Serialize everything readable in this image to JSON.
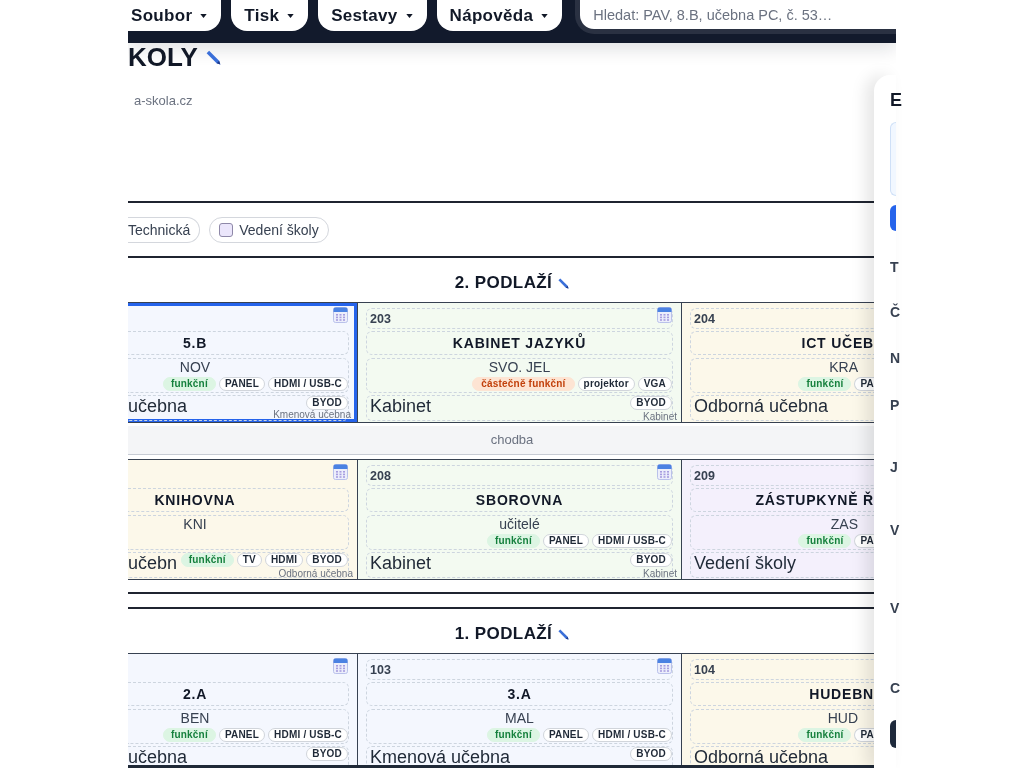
{
  "menu": [
    {
      "label": "Soubor"
    },
    {
      "label": "Tisk"
    },
    {
      "label": "Sestavy"
    },
    {
      "label": "Nápověda"
    }
  ],
  "search": {
    "placeholder": "Hledat: PAV, 8.B, učebna PC, č. 53…"
  },
  "page": {
    "title": "KOLY",
    "subtitle": "a-skola.cz"
  },
  "filters": [
    {
      "label": "Technická"
    },
    {
      "label": "Vedení školy",
      "checked": false,
      "color": "#ebe6fb"
    }
  ],
  "floors": [
    {
      "title": "2. PODLAŽÍ",
      "rows": [
        {
          "kind": "rooms",
          "rooms": [
            {
              "name": "5.B",
              "teacher": "NOV",
              "tags": [
                {
                  "label": "funkční",
                  "kind": "ok"
                },
                {
                  "label": "PANEL",
                  "kind": "feature"
                },
                {
                  "label": "HDMI / USB-C",
                  "kind": "feature"
                }
              ],
              "type": "učebna",
              "bottom_tags": [
                {
                  "label": "BYOD",
                  "kind": "feature"
                }
              ],
              "type_label": "Kmenová učebna",
              "color": "#f4f7fe",
              "selected": true
            },
            {
              "number": "203",
              "name": "KABINET JAZYKŮ",
              "teacher": "SVO. JEL",
              "tags": [
                {
                  "label": "částečně funkční",
                  "kind": "partial"
                },
                {
                  "label": "projektor",
                  "kind": "feature"
                },
                {
                  "label": "VGA",
                  "kind": "feature"
                }
              ],
              "type": "Kabinet",
              "bottom_tags": [
                {
                  "label": "BYOD",
                  "kind": "feature"
                }
              ],
              "type_label": "Kabinet",
              "color": "#f3faf1",
              "selected": false
            },
            {
              "number": "204",
              "name": "ICT UČEB",
              "teacher": "KRA",
              "tags": [
                {
                  "label": "funkční",
                  "kind": "ok"
                },
                {
                  "label": "PA",
                  "kind": "feature"
                }
              ],
              "type": "Odborná učebna",
              "color": "#fcf8ea",
              "selected": false
            }
          ]
        },
        {
          "kind": "corridor",
          "label": "chodba"
        },
        {
          "kind": "rooms",
          "rooms": [
            {
              "name": "KNIHOVNA",
              "teacher": "KNI",
              "type": "učebn",
              "bottom_tags": [
                {
                  "label": "funkční",
                  "kind": "ok"
                },
                {
                  "label": "TV",
                  "kind": "feature"
                },
                {
                  "label": "HDMI",
                  "kind": "feature"
                },
                {
                  "label": "BYOD",
                  "kind": "feature"
                }
              ],
              "type_label": "Odborná učebna",
              "color": "#fcf8ea",
              "selected": false
            },
            {
              "number": "208",
              "name": "SBOROVNA",
              "teacher": "učitelé",
              "tags": [
                {
                  "label": "funkční",
                  "kind": "ok"
                },
                {
                  "label": "PANEL",
                  "kind": "feature"
                },
                {
                  "label": "HDMI / USB-C",
                  "kind": "feature"
                }
              ],
              "type": "Kabinet",
              "bottom_tags": [
                {
                  "label": "BYOD",
                  "kind": "feature"
                }
              ],
              "type_label": "Kabinet",
              "color": "#f3faf1",
              "selected": false
            },
            {
              "number": "209",
              "name": "ZÁSTUPKYNĚ Ř",
              "teacher": "ZAS",
              "tags": [
                {
                  "label": "funkční",
                  "kind": "ok"
                },
                {
                  "label": "PA",
                  "kind": "feature"
                }
              ],
              "type": "Vedení školy",
              "color": "#f4f0fc",
              "selected": false
            }
          ]
        }
      ]
    },
    {
      "title": "1. PODLAŽÍ",
      "rows": [
        {
          "kind": "rooms",
          "rooms": [
            {
              "name": "2.A",
              "teacher": "BEN",
              "tags": [
                {
                  "label": "funkční",
                  "kind": "ok"
                },
                {
                  "label": "PANEL",
                  "kind": "feature"
                },
                {
                  "label": "HDMI / USB-C",
                  "kind": "feature"
                }
              ],
              "type": "učebna",
              "bottom_tags": [
                {
                  "label": "BYOD",
                  "kind": "feature"
                }
              ],
              "color": "#f4f7fe",
              "selected": false
            },
            {
              "number": "103",
              "name": "3.A",
              "teacher": "MAL",
              "tags": [
                {
                  "label": "funkční",
                  "kind": "ok"
                },
                {
                  "label": "PANEL",
                  "kind": "feature"
                },
                {
                  "label": "HDMI / USB-C",
                  "kind": "feature"
                }
              ],
              "type": "Kmenová učebna",
              "bottom_tags": [
                {
                  "label": "BYOD",
                  "kind": "feature"
                }
              ],
              "color": "#f4f7fe",
              "selected": false
            },
            {
              "number": "104",
              "name": "HUDEBN",
              "teacher": "HUD",
              "tags": [
                {
                  "label": "funkční",
                  "kind": "ok"
                },
                {
                  "label": "PA",
                  "kind": "feature"
                }
              ],
              "type": "Odborná učebna",
              "color": "#fcf8ea",
              "selected": false
            }
          ]
        }
      ]
    }
  ],
  "side_panel": {
    "heading": "E",
    "labels": [
      "T",
      "Č",
      "N",
      "P",
      "J",
      "V",
      "V",
      "C"
    ]
  }
}
